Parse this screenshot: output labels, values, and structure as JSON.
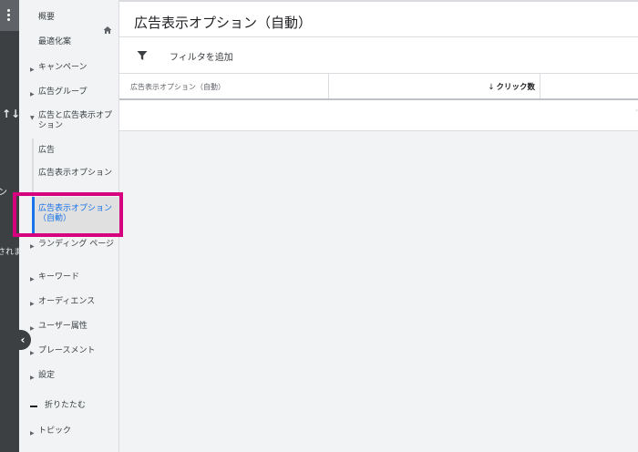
{
  "sidebar": {
    "items": [
      {
        "label": "概要"
      },
      {
        "label": "最適化案"
      },
      {
        "label": "キャンペーン"
      },
      {
        "label": "広告グループ"
      },
      {
        "label": "広告と広告表示オプション"
      },
      {
        "label": "広告"
      },
      {
        "label": "広告表示オプション"
      },
      {
        "label": "広告表示オプション（自動）"
      },
      {
        "label": "ランディング ページ"
      },
      {
        "label": "キーワード"
      },
      {
        "label": "オーディエンス"
      },
      {
        "label": "ユーザー属性"
      },
      {
        "label": "プレースメント"
      },
      {
        "label": "設定"
      },
      {
        "label": "折りたたむ"
      },
      {
        "label": "トピック"
      }
    ]
  },
  "rail": {
    "fragment_1": "ン",
    "fragment_2": "されま"
  },
  "main": {
    "title": "広告表示オプション（自動）",
    "filter_label": "フィルタを追加",
    "table": {
      "columns": [
        "広告表示オプション（自動）",
        "クリック数"
      ]
    }
  },
  "colors": {
    "accent": "#1a73e8",
    "highlight": "#d6007f",
    "rail": "#3c4043"
  }
}
